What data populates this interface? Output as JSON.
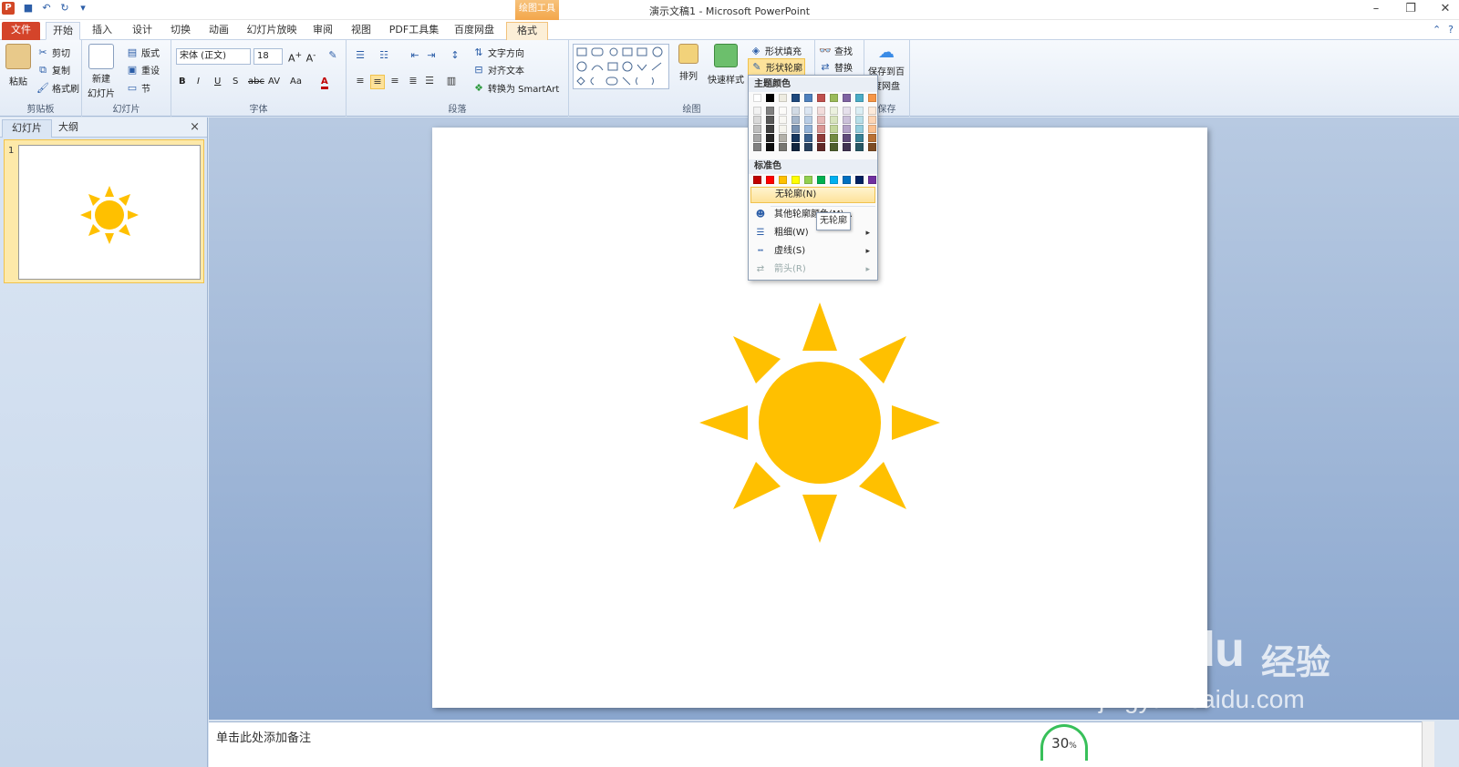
{
  "window": {
    "title": "演示文稿1 - Microsoft PowerPoint",
    "context_tool_label": "绘图工具",
    "app_logo_letter": "P"
  },
  "tabs": {
    "file": "文件",
    "home": "开始",
    "insert": "插入",
    "design": "设计",
    "transitions": "切换",
    "animations": "动画",
    "slideshow": "幻灯片放映",
    "review": "审阅",
    "view": "视图",
    "pdf": "PDF工具集",
    "baidu": "百度网盘",
    "format": "格式"
  },
  "ribbon": {
    "clipboard": {
      "label": "剪贴板",
      "paste": "粘贴",
      "cut": "剪切",
      "copy": "复制",
      "format_painter": "格式刷"
    },
    "slides": {
      "label": "幻灯片",
      "new_slide_line1": "新建",
      "new_slide_line2": "幻灯片",
      "layout": "版式",
      "reset": "重设",
      "section": "节"
    },
    "font": {
      "label": "字体",
      "font_name": "宋体 (正文)",
      "font_size": "18",
      "bold": "B",
      "italic": "I",
      "underline": "U",
      "shadow": "S",
      "strike": "abc",
      "spacing": "AV",
      "case": "Aa",
      "color": "A"
    },
    "paragraph": {
      "label": "段落",
      "text_direction": "文字方向",
      "align_text": "对齐文本",
      "smartart": "转换为 SmartArt"
    },
    "drawing": {
      "label": "绘图",
      "arrange": "排列",
      "quick_styles": "快速样式",
      "shape_fill": "形状填充",
      "shape_outline": "形状轮廓"
    },
    "editing": {
      "find": "查找",
      "replace": "替换"
    },
    "save": {
      "label": "保存",
      "save_line1": "保存到百",
      "save_line2": "度网盘"
    }
  },
  "left_panel": {
    "tab_slides": "幻灯片",
    "tab_outline": "大纲",
    "close": "×",
    "slide_number": "1"
  },
  "dropdown": {
    "theme_colors_heading": "主题颜色",
    "standard_colors_heading": "标准色",
    "no_outline": "无轮廓(N)",
    "more_colors": "其他轮廓颜色(M)...",
    "weight": "粗细(W)",
    "dashes": "虚线(S)",
    "arrows": "箭头(R)",
    "theme_top_row": [
      "#ffffff",
      "#000000",
      "#eeece1",
      "#1f497d",
      "#4f81bd",
      "#c0504d",
      "#9bbb59",
      "#8064a2",
      "#4bacc6",
      "#f79646"
    ],
    "standard_colors": [
      "#c00000",
      "#ff0000",
      "#ffc000",
      "#ffff00",
      "#92d050",
      "#00b050",
      "#00b0f0",
      "#0070c0",
      "#002060",
      "#7030a0"
    ]
  },
  "tooltip": "无轮廓",
  "notes_placeholder": "单击此处添加备注",
  "zoom_badge": {
    "value": "30",
    "unit": "%"
  },
  "watermark": {
    "logo": "Bai du",
    "cn": "经验",
    "url": "jingyan.baidu.com"
  },
  "colors": {
    "sun": "#ffc000",
    "accent_file_tab": "#d4442a",
    "context_tab": "#f3a64a"
  }
}
